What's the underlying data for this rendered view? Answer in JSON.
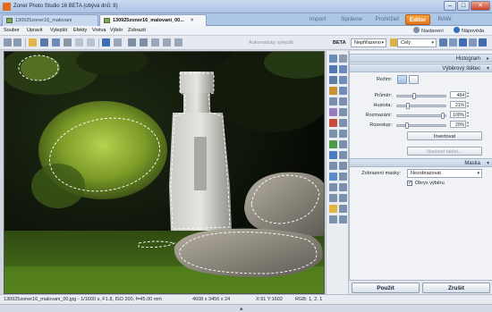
{
  "window": {
    "title": "Zoner Photo Studio 16 BETA (obývá dnů: 8)",
    "min": "–",
    "max": "□",
    "close": "✕"
  },
  "tabs": [
    {
      "label": "130925zoner16_malovani"
    },
    {
      "label": "130925zoner16_malovani_00..."
    }
  ],
  "modules": [
    "Import",
    "Správce",
    "Prohlížeč",
    "Editor",
    "RAW"
  ],
  "menu": {
    "items": [
      "Soubor",
      "Upravit",
      "Vylepšit",
      "Efekty",
      "Vrstva",
      "Výběr",
      "Zobrazit"
    ],
    "settings": "Nastavení",
    "help": "Nápověda"
  },
  "toolbar": {
    "auto_enhance": "Automaticky vylepšit",
    "beta": "BETA",
    "mode_select": "Nepřiřazeno",
    "zoom_select": "Celý"
  },
  "right_panel": {
    "histogram": "Histogram",
    "selection_brush": "Výběrový štětec",
    "mode_label": "Režim:",
    "params": [
      {
        "label": "Průměr:",
        "value": "484",
        "fill": 0.35
      },
      {
        "label": "Hustota:",
        "value": "21%",
        "fill": 0.21
      },
      {
        "label": "Rozmazání:",
        "value": "100%",
        "fill": 1.0
      },
      {
        "label": "Rozestup:",
        "value": "20%",
        "fill": 0.2
      }
    ],
    "invert": "Invertovat",
    "tablet": "Nastavit tablet...",
    "mask": "Maska",
    "mask_display_label": "Zobrazení masky:",
    "mask_display_value": "Nezobrazovat",
    "outline_label": "Obrys výběru",
    "outline_checked": true
  },
  "actions": {
    "apply": "Použít",
    "cancel": "Zrušit"
  },
  "status": {
    "file": "130925zoner16_malovani_00.jpg - 1/1600 s, F1.8, ISO 200, f=45.00 mm",
    "size": "4608 x 3456 x 24",
    "coords": "X:91 Y:1602",
    "rgb": "RGB: 1, 2, 1"
  }
}
